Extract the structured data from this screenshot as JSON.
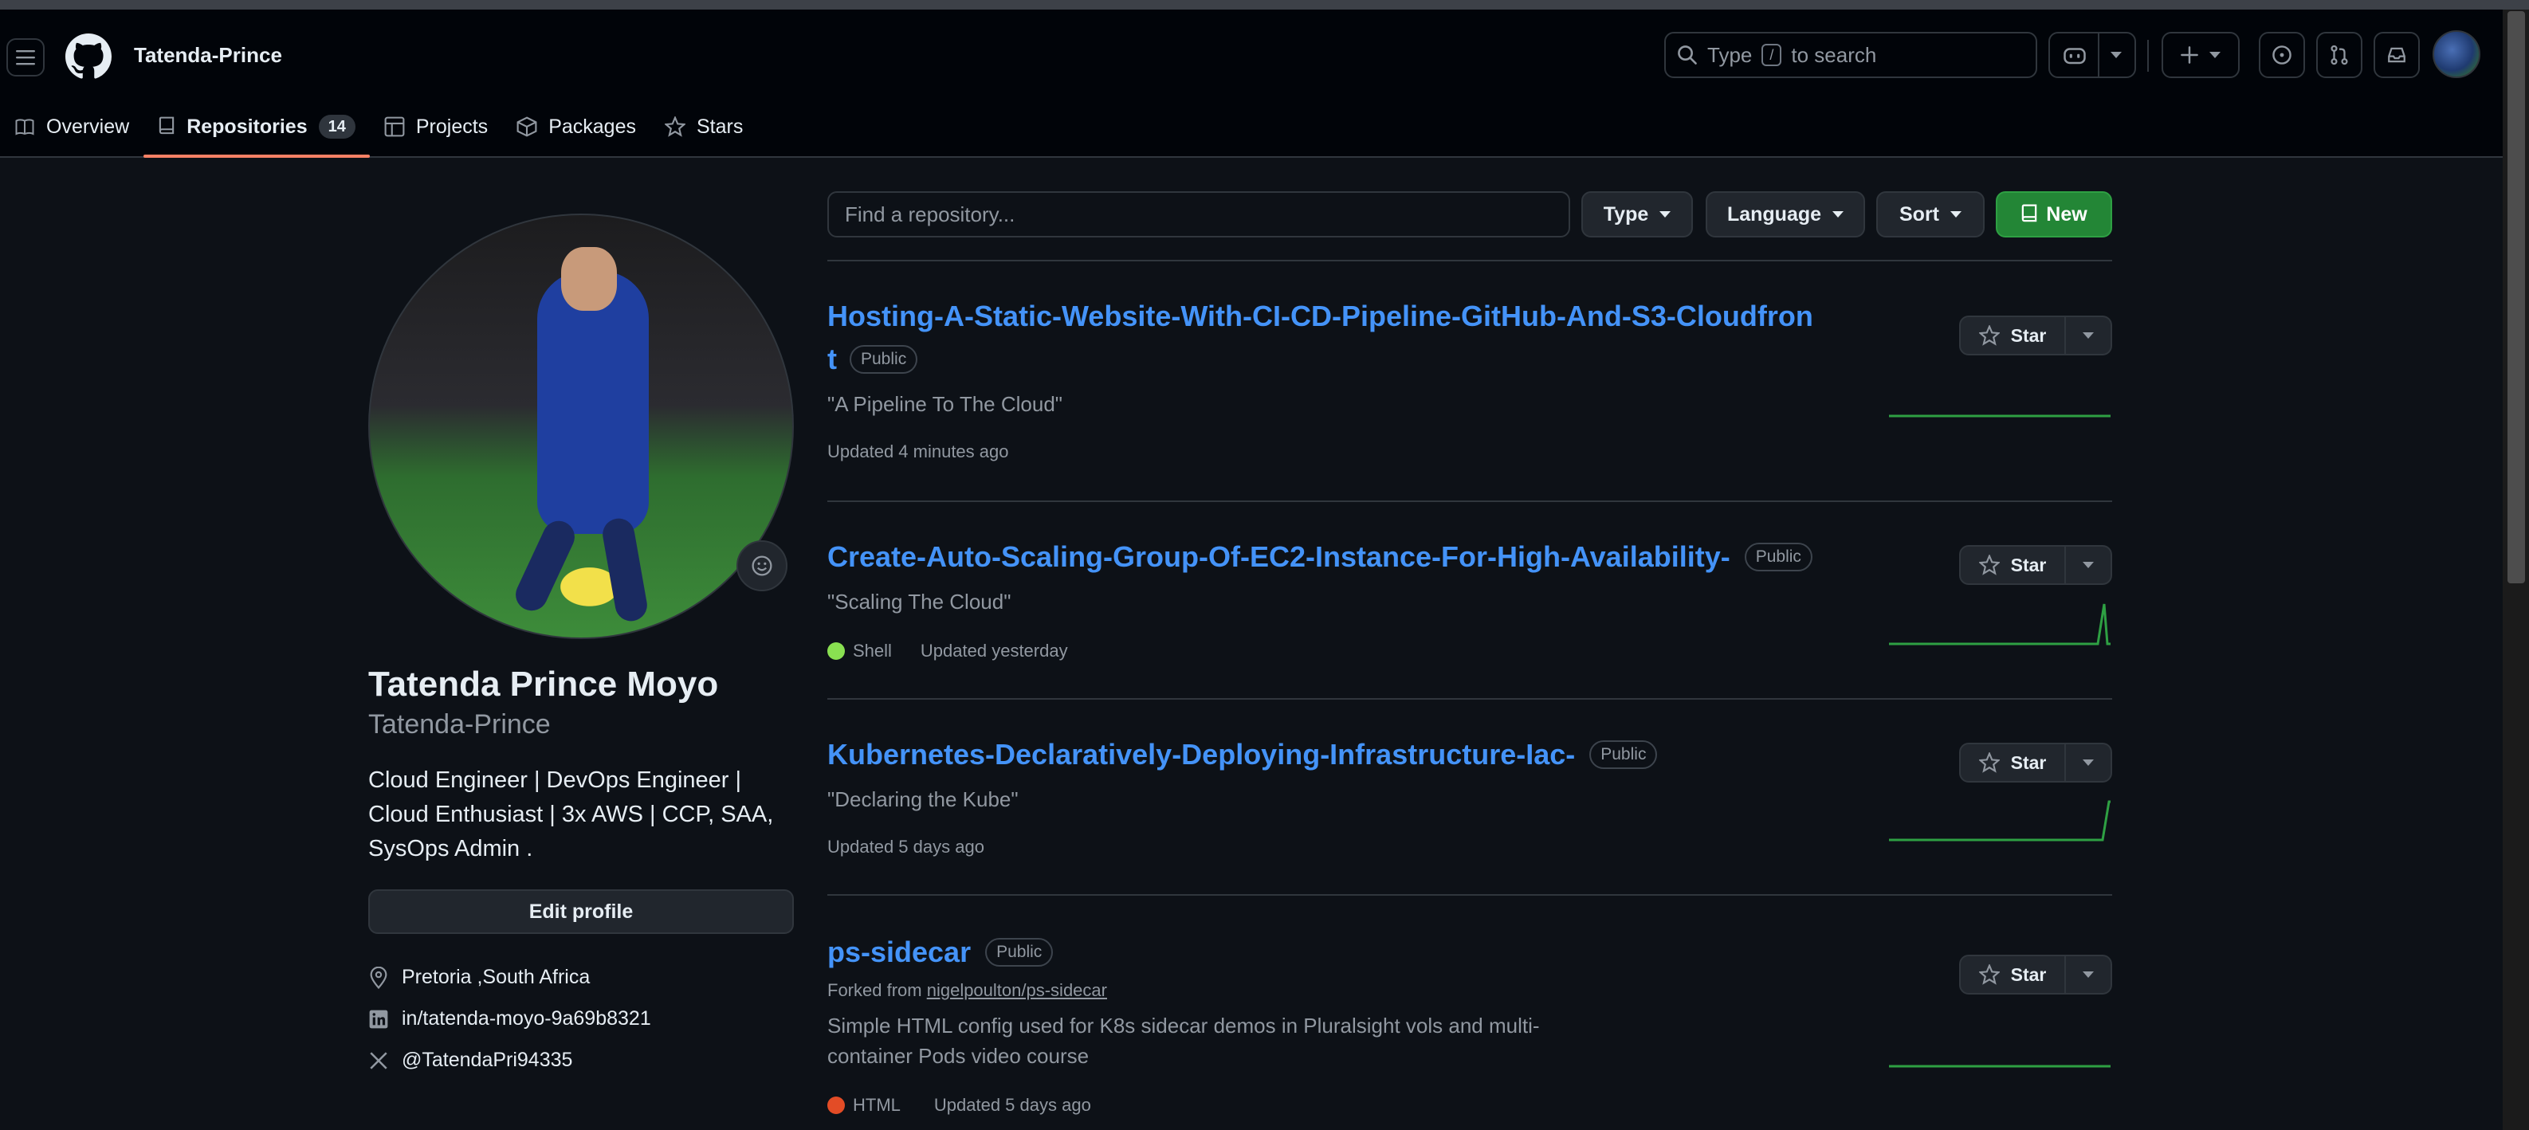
{
  "header": {
    "username": "Tatenda-Prince",
    "search_placeholder_pre": "Type",
    "search_key": "/",
    "search_placeholder_post": "to search"
  },
  "tabs": [
    {
      "label": "Overview",
      "icon": "book-icon"
    },
    {
      "label": "Repositories",
      "icon": "repo-icon",
      "count": "14"
    },
    {
      "label": "Projects",
      "icon": "table-icon"
    },
    {
      "label": "Packages",
      "icon": "package-icon"
    },
    {
      "label": "Stars",
      "icon": "star-icon"
    }
  ],
  "profile": {
    "full_name": "Tatenda Prince Moyo",
    "login": "Tatenda-Prince",
    "bio": "Cloud Engineer | DevOps Engineer | Cloud Enthusiast | 3x AWS | CCP, SAA, SysOps Admin .",
    "edit_label": "Edit profile",
    "location": "Pretoria ,South Africa",
    "linkedin": "in/tatenda-moyo-9a69b8321",
    "twitter": "@TatendaPri94335"
  },
  "filters": {
    "find_placeholder": "Find a repository...",
    "type_label": "Type",
    "language_label": "Language",
    "sort_label": "Sort",
    "new_label": "New"
  },
  "repos": [
    {
      "name_line1": "Hosting-A-Static-Website-With-CI-CD-Pipeline-GitHub-And-S3-Cloudfron",
      "name_line2": "t",
      "visibility": "Public",
      "description": "\"A Pipeline To The Cloud\"",
      "updated": "Updated 4 minutes ago",
      "star_label": "Star"
    },
    {
      "name": "Create-Auto-Scaling-Group-Of-EC2-Instance-For-High-Availability-",
      "visibility": "Public",
      "description": "\"Scaling The Cloud\"",
      "language": "Shell",
      "language_color": "#89e051",
      "updated": "Updated yesterday",
      "star_label": "Star"
    },
    {
      "name": "Kubernetes-Declaratively-Deploying-Infrastructure-Iac-",
      "visibility": "Public",
      "description": "\"Declaring the Kube\"",
      "updated": "Updated 5 days ago",
      "star_label": "Star"
    },
    {
      "name": "ps-sidecar",
      "visibility": "Public",
      "forked_prefix": "Forked from",
      "forked_from": "nigelpoulton/ps-sidecar",
      "description_line1": "Simple HTML config used for K8s sidecar demos in Pluralsight vols and multi-",
      "description_line2": "container Pods video course",
      "language": "HTML",
      "language_color": "#e34c26",
      "updated": "Updated 5 days ago",
      "star_label": "Star"
    }
  ],
  "colors": {
    "accent_link": "#4493f8",
    "new_button": "#238636",
    "active_tab_underline": "#f78166",
    "sparkline": "#2ea043"
  }
}
